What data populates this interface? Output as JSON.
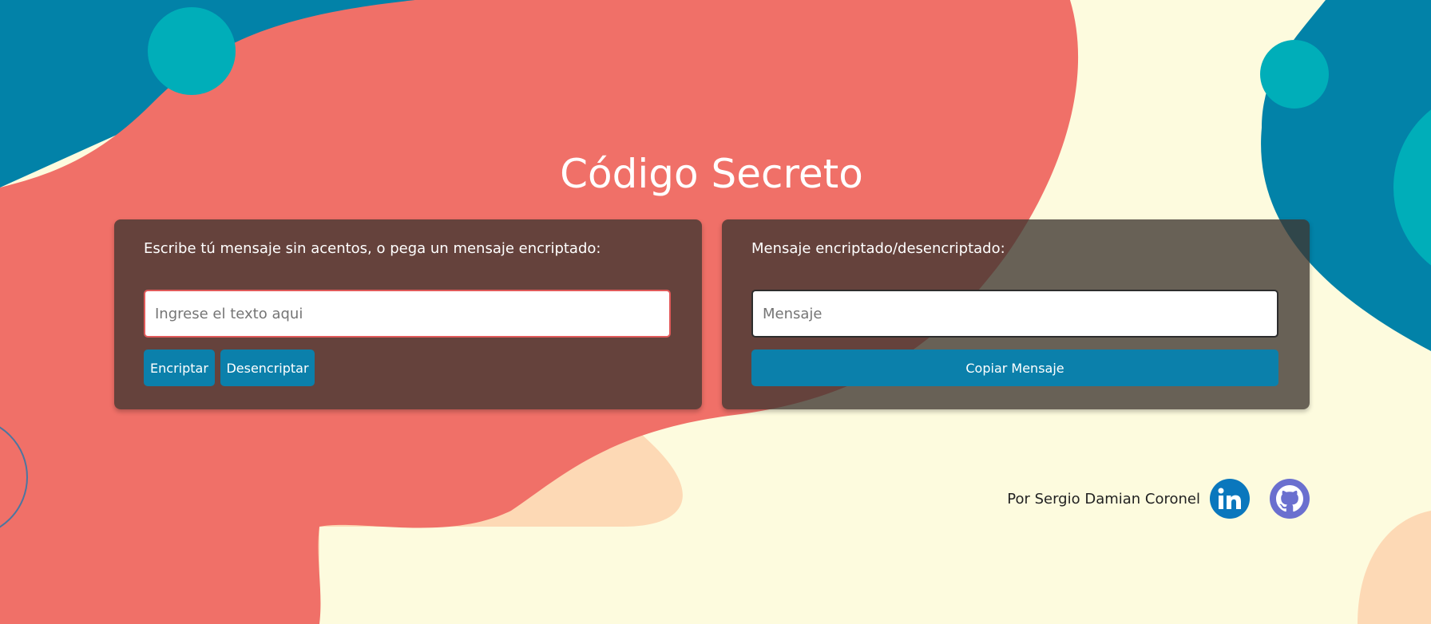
{
  "page": {
    "title": "Código Secreto"
  },
  "encrypt_panel": {
    "label": "Escribe tú mensaje sin acentos, o pega un mensaje encriptado:",
    "input_value": "",
    "input_placeholder": "Ingrese el texto aqui",
    "encrypt_button_label": "Encriptar",
    "decrypt_button_label": "Desencriptar"
  },
  "result_panel": {
    "label": "Mensaje encriptado/desencriptado:",
    "output_value": "",
    "output_placeholder": "Mensaje",
    "copy_button_label": "Copiar Mensaje"
  },
  "footer": {
    "author_text": "Por Sergio Damian Coronel",
    "links": [
      {
        "icon": "linkedin-icon"
      },
      {
        "icon": "github-icon"
      }
    ]
  },
  "colors": {
    "background": "#fdfbde",
    "coral": "#f07068",
    "teal_dark": "#0282a8",
    "teal_light": "#00aeb9",
    "peach": "#fdd9b5",
    "button": "#0b80ab",
    "linkedin": "#0a77bd",
    "github": "#6a6fcf"
  }
}
